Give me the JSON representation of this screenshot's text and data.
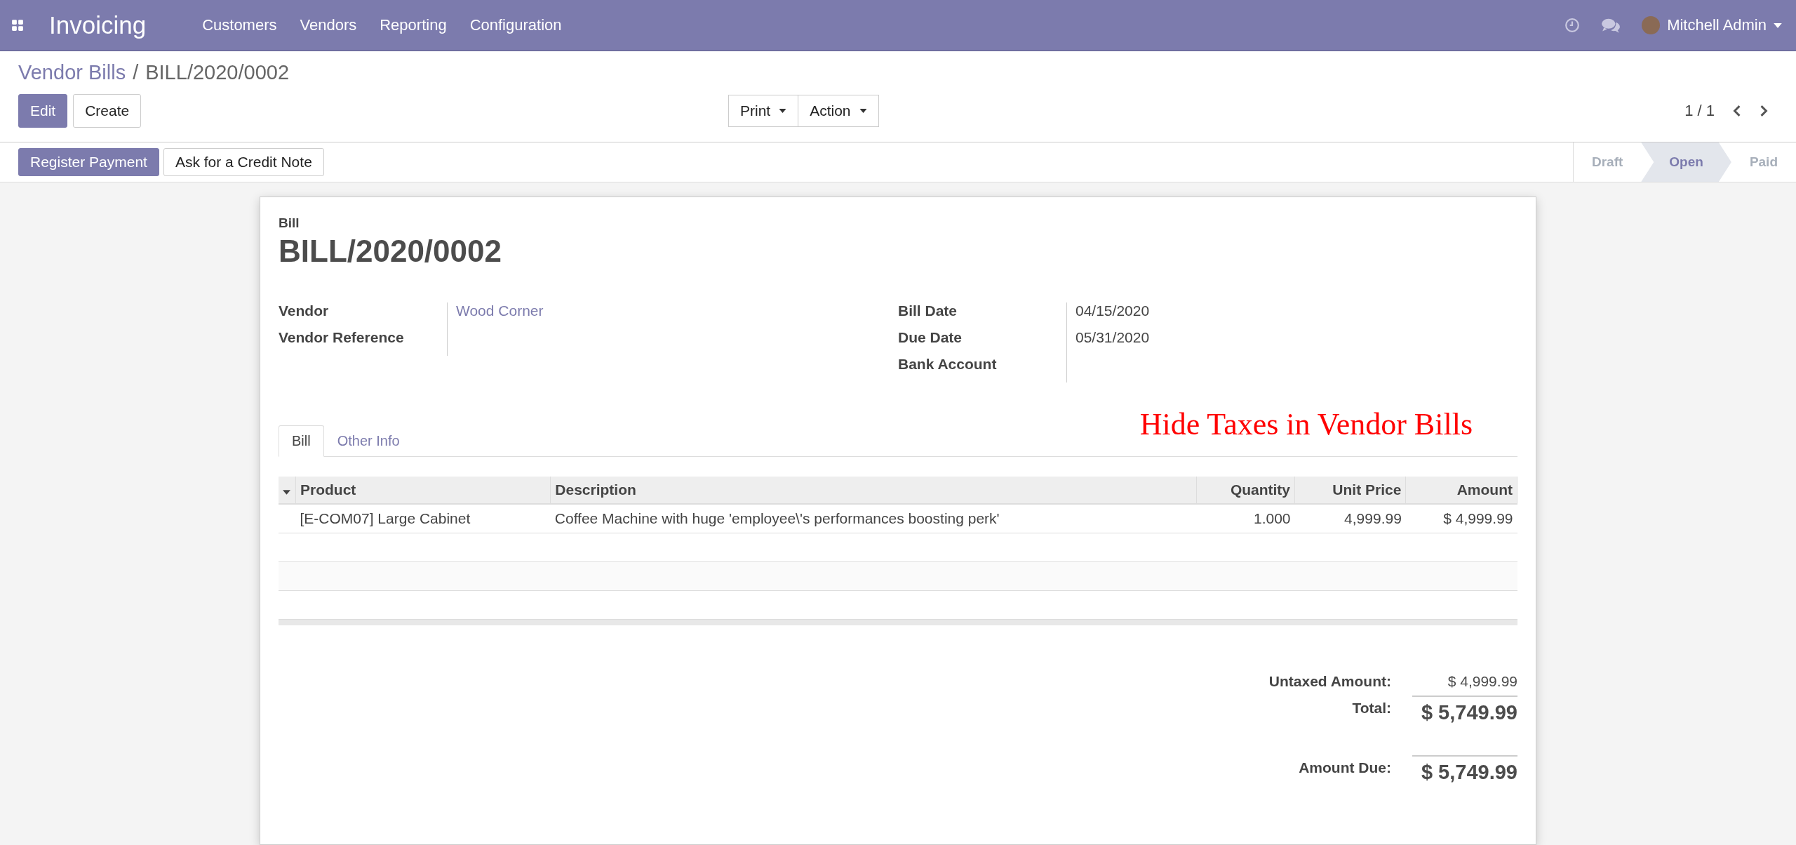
{
  "navbar": {
    "app_name": "Invoicing",
    "menu": [
      "Customers",
      "Vendors",
      "Reporting",
      "Configuration"
    ],
    "user": "Mitchell Admin"
  },
  "breadcrumb": {
    "parent": "Vendor Bills",
    "separator": "/",
    "current": "BILL/2020/0002"
  },
  "actions": {
    "primary": "Edit",
    "secondary": "Create",
    "dropdowns": [
      "Print",
      "Action"
    ],
    "pager": "1 / 1"
  },
  "header_buttons": [
    {
      "label": "Register Payment",
      "primary": true
    },
    {
      "label": "Ask for a Credit Note",
      "primary": false
    }
  ],
  "statusbar": [
    {
      "label": "Draft",
      "selected": false
    },
    {
      "label": "Open",
      "selected": true
    },
    {
      "label": "Paid",
      "selected": false
    }
  ],
  "sheet": {
    "type_label": "Bill",
    "title": "BILL/2020/0002",
    "left_fields": [
      {
        "label": "Vendor",
        "value": "Wood Corner",
        "link": true
      },
      {
        "label": "Vendor Reference"
      }
    ],
    "right_fields": [
      {
        "label": "Bill Date",
        "value": "04/15/2020",
        "link": false
      },
      {
        "label": "Due Date",
        "value": "05/31/2020",
        "link": false
      },
      {
        "label": "Bank Account"
      }
    ],
    "annotation": "Hide Taxes in Vendor Bills",
    "tabs": [
      {
        "label": "Bill",
        "selected": true
      },
      {
        "label": "Other Info",
        "selected": false
      }
    ],
    "table": {
      "columns": [
        "Product",
        "Description",
        "Quantity",
        "Unit Price",
        "Amount"
      ],
      "rows": [
        [
          "[E-COM07] Large Cabinet",
          "Coffee Machine with huge 'employee\\'s performances boosting perk'",
          "1.000",
          "4,999.99",
          "$ 4,999.99"
        ]
      ]
    },
    "totals": [
      {
        "label": "Untaxed Amount:",
        "value": "$ 4,999.99",
        "kind": "plain"
      },
      {
        "label": "Total:",
        "value": "$ 5,749.99",
        "kind": "grand"
      },
      {
        "label": "Amount Due:",
        "value": "$ 5,749.99",
        "kind": "due"
      }
    ]
  }
}
